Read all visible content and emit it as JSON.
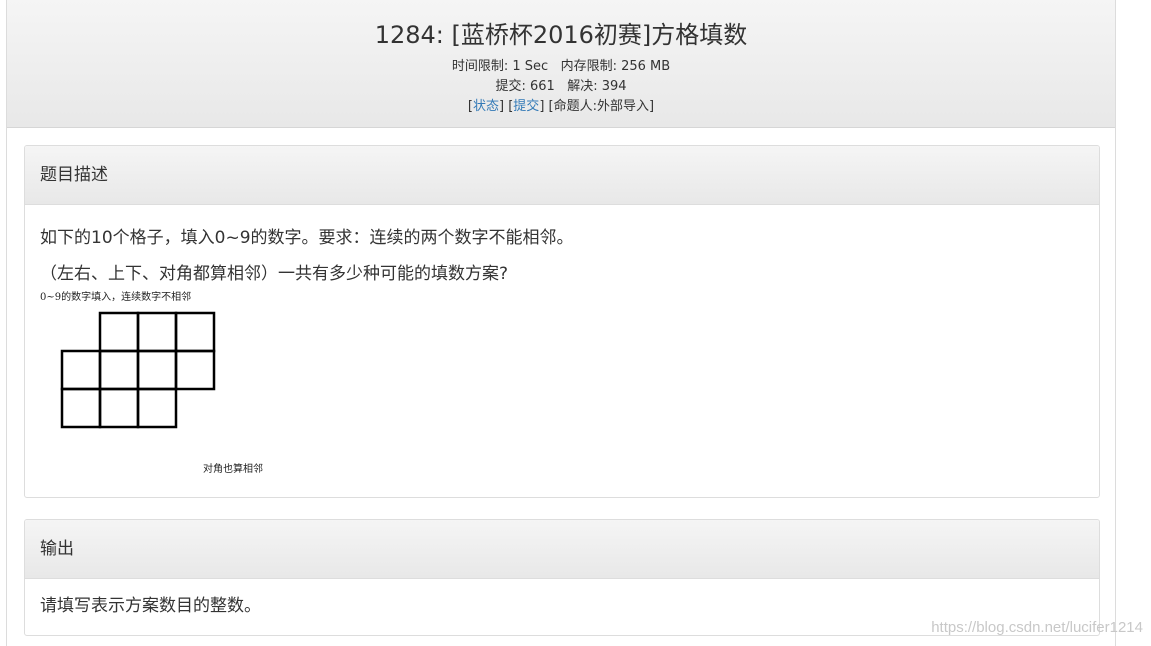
{
  "header": {
    "title": "1284: [蓝桥杯2016初赛]方格填数",
    "time_limit_label": "时间限制:",
    "time_limit_value": "1 Sec",
    "memory_limit_label": "内存限制:",
    "memory_limit_value": "256 MB",
    "submit_label": "提交:",
    "submit_value": "661",
    "solved_label": "解决:",
    "solved_value": "394",
    "status_link": "状态",
    "submit_link": "提交",
    "author": "[命题人:外部导入]"
  },
  "description": {
    "heading": "题目描述",
    "line1": "如下的10个格子，填入0~9的数字。要求：连续的两个数字不能相邻。",
    "line2": "（左右、上下、对角都算相邻）一共有多少种可能的填数方案?",
    "figure_caption_top": "0~9的数字填入，连续数字不相邻",
    "figure_caption_bottom": "对角也算相邻",
    "grid": {
      "rows": 3,
      "cols": 4,
      "filled": [
        [
          false,
          true,
          true,
          true
        ],
        [
          true,
          true,
          true,
          true
        ],
        [
          true,
          true,
          true,
          false
        ]
      ]
    }
  },
  "output": {
    "heading": "输出",
    "text": "请填写表示方案数目的整数。"
  },
  "watermark": "https://blog.csdn.net/lucifer1214"
}
